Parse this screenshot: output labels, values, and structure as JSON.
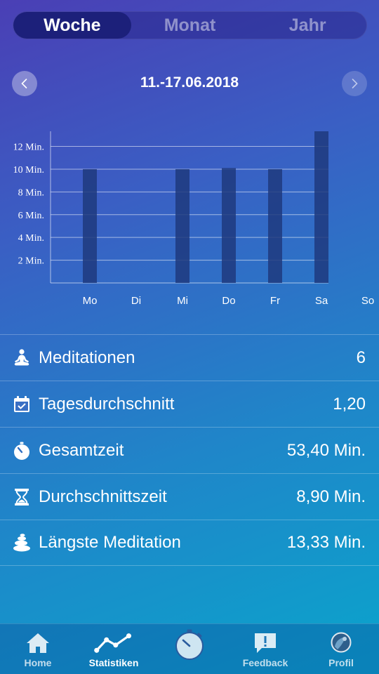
{
  "segments": [
    "Woche",
    "Monat",
    "Jahr"
  ],
  "selected_segment": "Woche",
  "date_range": "11.-17.06.2018",
  "colors": {
    "bar": "#1e3a7e",
    "accent": "#ffffff"
  },
  "chart_data": {
    "type": "bar",
    "categories": [
      "Mo",
      "Di",
      "Mi",
      "Do",
      "Fr",
      "Sa",
      "So"
    ],
    "values": [
      10,
      0,
      10,
      10.1,
      10,
      13.33,
      0
    ],
    "ytick_labels": [
      "2 Min.",
      "4 Min.",
      "6 Min.",
      "8 Min.",
      "10 Min.",
      "12 Min."
    ],
    "yticks": [
      2,
      4,
      6,
      8,
      10,
      12
    ],
    "ylim": [
      0,
      13.33
    ],
    "grid": true
  },
  "stats": [
    {
      "icon": "meditation-icon",
      "label": "Meditationen",
      "value": "6"
    },
    {
      "icon": "calendar-icon",
      "label": "Tagesdurchschnitt",
      "value": "1,20"
    },
    {
      "icon": "stopwatch-icon",
      "label": "Gesamtzeit",
      "value": "53,40 Min."
    },
    {
      "icon": "hourglass-icon",
      "label": "Durchschnittszeit",
      "value": "8,90 Min."
    },
    {
      "icon": "stones-icon",
      "label": "Längste Meditation",
      "value": "13,33 Min."
    }
  ],
  "tabs": [
    {
      "icon": "home-icon",
      "label": "Home"
    },
    {
      "icon": "statistics-icon",
      "label": "Statistiken",
      "active": true
    },
    {
      "icon": "timer-icon",
      "label": ""
    },
    {
      "icon": "feedback-icon",
      "label": "Feedback"
    },
    {
      "icon": "profile-icon",
      "label": "Profil"
    }
  ]
}
